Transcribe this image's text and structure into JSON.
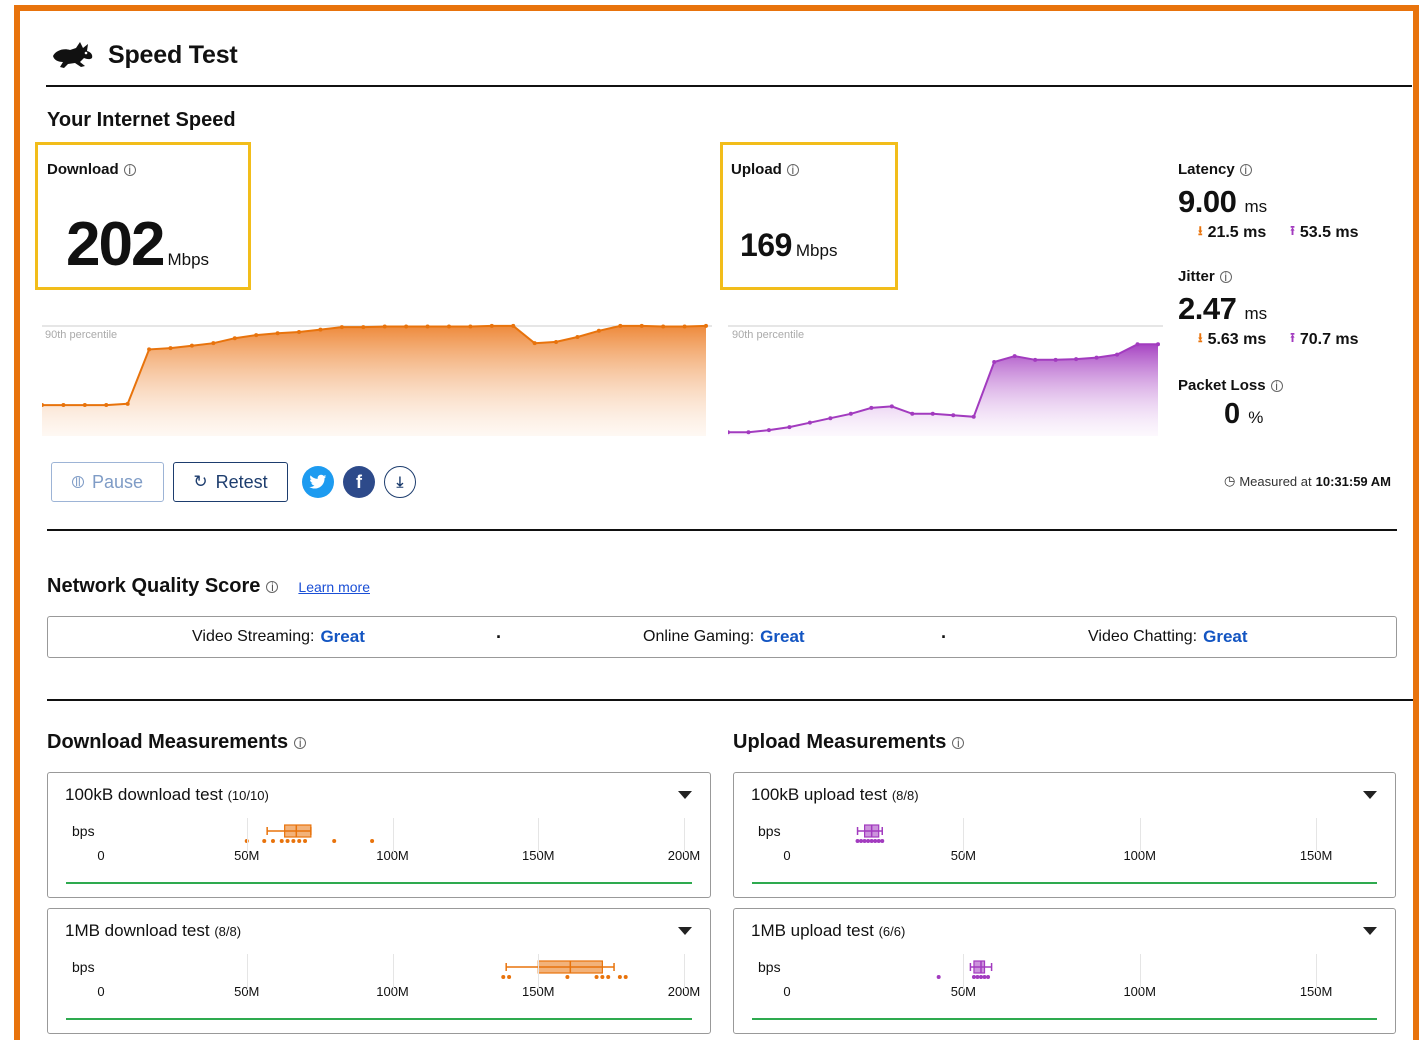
{
  "app": {
    "title": "Speed Test"
  },
  "speed": {
    "section_title": "Your Internet Speed",
    "download": {
      "label": "Download",
      "value": "202",
      "unit": "Mbps"
    },
    "upload": {
      "label": "Upload",
      "value": "169",
      "unit": "Mbps"
    },
    "percentile_label": "90th percentile",
    "latency": {
      "label": "Latency",
      "value": "9.00",
      "unit": "ms",
      "down": "21.5 ms",
      "up": "53.5 ms"
    },
    "jitter": {
      "label": "Jitter",
      "value": "2.47",
      "unit": "ms",
      "down": "5.63 ms",
      "up": "70.7 ms"
    },
    "packet_loss": {
      "label": "Packet Loss",
      "value": "0",
      "unit": "%"
    },
    "measured": {
      "prefix": "Measured at",
      "time": "10:31:59 AM"
    }
  },
  "controls": {
    "pause_label": "Pause",
    "retest_label": "Retest"
  },
  "network_quality": {
    "title": "Network Quality Score",
    "learn_more": "Learn more",
    "items": [
      {
        "label": "Video Streaming:",
        "rating": "Great"
      },
      {
        "label": "Online Gaming:",
        "rating": "Great"
      },
      {
        "label": "Video Chatting:",
        "rating": "Great"
      }
    ]
  },
  "download_measurements": {
    "title": "Download Measurements",
    "tests": [
      {
        "name": "100kB download test",
        "count": "(10/10)",
        "axis_label": "bps",
        "ticks": [
          "0",
          "50M",
          "100M",
          "150M",
          "200M"
        ]
      },
      {
        "name": "1MB download test",
        "count": "(8/8)",
        "axis_label": "bps",
        "ticks": [
          "0",
          "50M",
          "100M",
          "150M",
          "200M"
        ]
      }
    ]
  },
  "upload_measurements": {
    "title": "Upload Measurements",
    "tests": [
      {
        "name": "100kB upload test",
        "count": "(8/8)",
        "axis_label": "bps",
        "ticks": [
          "0",
          "50M",
          "100M",
          "150M"
        ]
      },
      {
        "name": "1MB upload test",
        "count": "(6/6)",
        "axis_label": "bps",
        "ticks": [
          "0",
          "50M",
          "100M",
          "150M"
        ]
      }
    ]
  },
  "colors": {
    "download": "#e8730c",
    "upload": "#a23bbf",
    "accent": "#1355c2",
    "highlight": "#f2bd1a",
    "good_line": "#2eaa4f"
  },
  "chart_data": [
    {
      "type": "area",
      "title": "",
      "series": [
        {
          "values": [
            50,
            50,
            50,
            50,
            52,
            140,
            142,
            146,
            150,
            158,
            163,
            166,
            168,
            172,
            176,
            176,
            177,
            177,
            177,
            177,
            177,
            178,
            178,
            150,
            152,
            160,
            170,
            178,
            178,
            177,
            177,
            178
          ]
        }
      ],
      "ylim": [
        0,
        202
      ]
    },
    {
      "type": "area",
      "title": "",
      "series": [
        {
          "values": [
            5,
            5,
            8,
            12,
            18,
            24,
            30,
            38,
            40,
            30,
            30,
            28,
            26,
            100,
            108,
            103,
            103,
            104,
            106,
            110,
            124,
            124
          ]
        }
      ],
      "ylim": [
        0,
        169
      ]
    },
    {
      "type": "scatter",
      "title": "100kB download test",
      "xlabel": "bps",
      "xlim": [
        0,
        220
      ],
      "points": [
        50,
        56,
        59,
        62,
        64,
        66,
        68,
        70,
        80,
        93
      ],
      "box": {
        "q1": 63,
        "median": 67,
        "q3": 72,
        "min": 57,
        "max": 72
      }
    },
    {
      "type": "scatter",
      "title": "1MB download test",
      "xlabel": "bps",
      "xlim": [
        0,
        220
      ],
      "points": [
        138,
        140,
        160,
        170,
        172,
        174,
        178,
        180
      ],
      "box": {
        "q1": 150,
        "median": 161,
        "q3": 172,
        "min": 139,
        "max": 176
      }
    },
    {
      "type": "scatter",
      "title": "100kB upload test",
      "xlabel": "bps",
      "xlim": [
        0,
        180
      ],
      "points": [
        20,
        21,
        22,
        23,
        24,
        25,
        26,
        27
      ],
      "box": {
        "q1": 22,
        "median": 24,
        "q3": 26,
        "min": 20,
        "max": 27
      }
    },
    {
      "type": "scatter",
      "title": "1MB upload test",
      "xlabel": "bps",
      "xlim": [
        0,
        180
      ],
      "points": [
        43,
        53,
        54,
        55,
        56,
        57
      ],
      "box": {
        "q1": 53,
        "median": 55,
        "q3": 56,
        "min": 52,
        "max": 58
      }
    }
  ]
}
